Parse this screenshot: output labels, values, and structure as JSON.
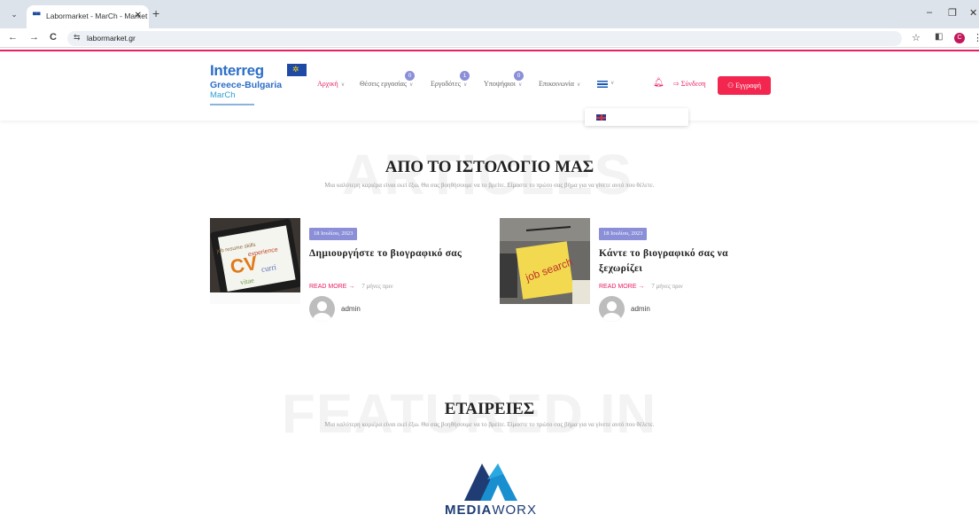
{
  "browser": {
    "tab_title": "Labormarket - MarCh - Market",
    "tab_close": "✕",
    "new_tab": "+",
    "url": "labormarket.gr",
    "back": "←",
    "forward": "→",
    "reload": "C",
    "star": "☆",
    "minimize": "–",
    "restore": "❐",
    "close": "✕",
    "profile_initial": "C"
  },
  "logo": {
    "line1": "Interreg",
    "line2": "Greece-Bulgaria",
    "line3": "MarCh"
  },
  "nav": {
    "items": [
      {
        "label": "Αρχική",
        "active": true
      },
      {
        "label": "Θέσεις εργασίας",
        "badge": "0"
      },
      {
        "label": "Εργοδότες",
        "badge": "1"
      },
      {
        "label": "Υποψήφιοι",
        "badge": "0"
      },
      {
        "label": "Επικοινωνία"
      }
    ],
    "login": "Σύνδεση",
    "register": "Εγγραφή"
  },
  "blog": {
    "watermark": "ARTICLES",
    "title": "ΑΠΟ ΤΟ ΙΣΤΟΛΟΓΙΟ ΜΑΣ",
    "subtitle": "Μια καλύτερη καριέρα είναι εκεί έξω. Θα σας βοηθήσουμε να το βρείτε. Είμαστε το πρώτο σας βήμα για να γίνετε αυτό που θέλετε.",
    "posts": [
      {
        "date": "18 Ιουλίου, 2023",
        "title": "Δημιουργήστε το βιογραφικό σας",
        "read_more": "READ MORE →",
        "ago": "7 μήνες πριν",
        "author": "admin",
        "image_text": "CV"
      },
      {
        "date": "18 Ιουλίου, 2023",
        "title": "Κάντε το βιογραφικό σας να ξεχωρίζει",
        "read_more": "READ MORE →",
        "ago": "7 μήνες πριν",
        "author": "admin",
        "image_text": "job search"
      }
    ]
  },
  "companies": {
    "watermark": "FEATURED IN",
    "title": "ΕΤΑΙΡΕΙΕΣ",
    "subtitle": "Μια καλύτερη καριέρα είναι εκεί έξω. Θα σας βοηθήσουμε να το βρείτε. Είμαστε το πρώτο σας βήμα για να γίνετε αυτό που θέλετε.",
    "logo_bold": "MEDIA",
    "logo_thin": "WORX"
  },
  "colors": {
    "accent": "#e91e63",
    "badge": "#8b8fd8",
    "brand_blue": "#2d6fc7"
  }
}
